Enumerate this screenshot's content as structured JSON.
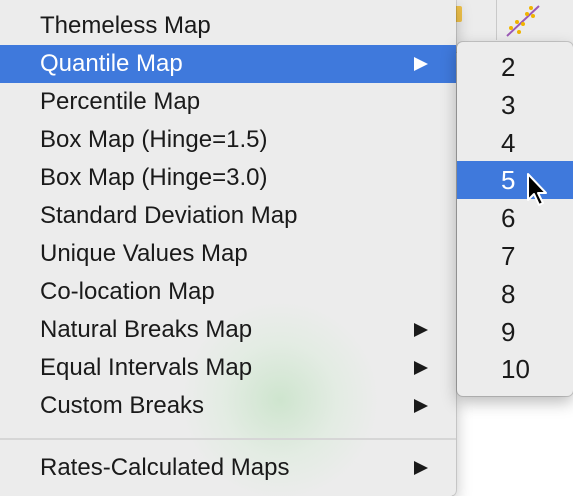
{
  "menu": {
    "items": [
      {
        "label": "Themeless Map",
        "has_submenu": false,
        "selected": false
      },
      {
        "label": "Quantile Map",
        "has_submenu": true,
        "selected": true
      },
      {
        "label": "Percentile Map",
        "has_submenu": false,
        "selected": false
      },
      {
        "label": "Box Map (Hinge=1.5)",
        "has_submenu": false,
        "selected": false
      },
      {
        "label": "Box Map (Hinge=3.0)",
        "has_submenu": false,
        "selected": false
      },
      {
        "label": "Standard Deviation Map",
        "has_submenu": false,
        "selected": false
      },
      {
        "label": "Unique Values Map",
        "has_submenu": false,
        "selected": false
      },
      {
        "label": "Co-location Map",
        "has_submenu": false,
        "selected": false
      },
      {
        "label": "Natural Breaks Map",
        "has_submenu": true,
        "selected": false
      },
      {
        "label": "Equal Intervals Map",
        "has_submenu": true,
        "selected": false
      },
      {
        "label": "Custom Breaks",
        "has_submenu": true,
        "selected": false
      },
      {
        "label": "Rates-Calculated Maps",
        "has_submenu": true,
        "selected": false
      }
    ]
  },
  "submenu": {
    "items": [
      {
        "label": "2",
        "selected": false
      },
      {
        "label": "3",
        "selected": false
      },
      {
        "label": "4",
        "selected": false
      },
      {
        "label": "5",
        "selected": true
      },
      {
        "label": "6",
        "selected": false
      },
      {
        "label": "7",
        "selected": false
      },
      {
        "label": "8",
        "selected": false
      },
      {
        "label": "9",
        "selected": false
      },
      {
        "label": "10",
        "selected": false
      }
    ]
  },
  "colors": {
    "highlight": "#3f79dc",
    "menu_background": "#ececec"
  }
}
